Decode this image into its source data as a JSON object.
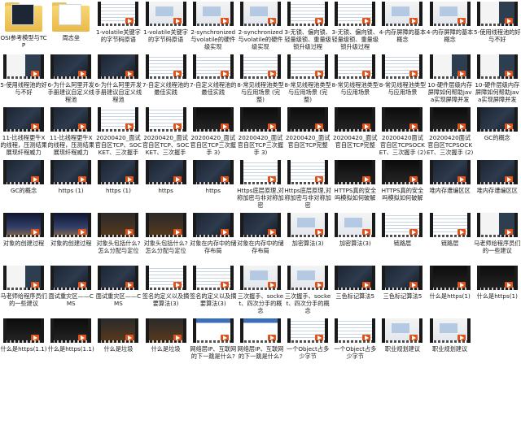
{
  "colors": {
    "film_border": "#1a1a1a",
    "play_badge": "#e0541b",
    "folder": "#eab94a",
    "label_text": "#1a1a1a"
  },
  "items": [
    {
      "type": "folder",
      "thumb": "dark",
      "label": "OSI参考模型与TCP"
    },
    {
      "type": "folder",
      "thumb": "light",
      "label": "周志垒"
    },
    {
      "type": "video",
      "thumb": "doc",
      "label": "1-volatile关键字的字节码原语"
    },
    {
      "type": "video",
      "thumb": "slide",
      "label": "1-volatile关键字的字节码原语"
    },
    {
      "type": "video",
      "thumb": "slide",
      "label": "2-synchronized与volatile的硬件级实现"
    },
    {
      "type": "video",
      "thumb": "slide",
      "label": "2-synchronized与volatile的硬件级实现"
    },
    {
      "type": "video",
      "thumb": "doc",
      "label": "3-无锁、偏向锁、轻量级锁、重量级锁升级过程"
    },
    {
      "type": "video",
      "thumb": "doc",
      "label": "3-无锁、偏向锁、轻量级锁、重量级锁升级过程"
    },
    {
      "type": "video",
      "thumb": "slide",
      "label": "4-内存屏障的基本概念"
    },
    {
      "type": "video",
      "thumb": "slide",
      "label": "4-内存屏障的基本概念"
    },
    {
      "type": "video",
      "thumb": "mixed",
      "label": "5-使用线程池的好与不好"
    },
    {
      "type": "video",
      "thumb": "mixed",
      "label": "5-使用线程池的好与不好"
    },
    {
      "type": "video",
      "thumb": "dark",
      "label": "6-为什么阿里开发手册建议自定义线程池"
    },
    {
      "type": "video",
      "thumb": "dark",
      "label": "6-为什么阿里开发手册建议自定义线程池"
    },
    {
      "type": "video",
      "thumb": "doc",
      "label": "7-自定义线程池的最佳实践"
    },
    {
      "type": "video",
      "thumb": "doc",
      "label": "7-自定义线程池的最佳实践"
    },
    {
      "type": "video",
      "thumb": "doc",
      "label": "8-常见线程池类型与应用场景 (完整)"
    },
    {
      "type": "video",
      "thumb": "doc",
      "label": "8-常见线程池类型与应用场景 (完整)"
    },
    {
      "type": "video",
      "thumb": "doc",
      "label": "8-常见线程池类型与应用场景"
    },
    {
      "type": "video",
      "thumb": "doc",
      "label": "8-常见线程池类型与应用场景"
    },
    {
      "type": "video",
      "thumb": "mixed",
      "label": "10-硬件层级内存屏障如何帮助java实现屏障并发"
    },
    {
      "type": "video",
      "thumb": "mixed",
      "label": "10-硬件层级内存屏障如何帮助java实现屏障并发"
    },
    {
      "type": "video",
      "thumb": "dark",
      "label": "11-比线程更牛X的线程，压测结果展现纤程威力"
    },
    {
      "type": "video",
      "thumb": "dark",
      "label": "11-比线程更牛X的线程，压测结果展现纤程威力"
    },
    {
      "type": "video",
      "thumb": "doc",
      "label": "20200420_面试官自区TCP、SOCKET、三次握手"
    },
    {
      "type": "video",
      "thumb": "doc",
      "label": "20200420_面试官自区TCP、SOCKET、三次握手"
    },
    {
      "type": "video",
      "thumb": "black",
      "label": "20200420_面试官自区TCP三次握手 3)"
    },
    {
      "type": "video",
      "thumb": "black",
      "label": "20200420_面试官自区TCP三次握手 3)"
    },
    {
      "type": "video",
      "thumb": "black",
      "label": "20200420_面试官自区TCP完整"
    },
    {
      "type": "video",
      "thumb": "black",
      "label": "20200420_面试官自区TCP完整"
    },
    {
      "type": "video",
      "thumb": "black",
      "label": "20200420面试官自区TCPSOCKET、三次握手 (2)"
    },
    {
      "type": "video",
      "thumb": "black",
      "label": "20200420面试官自区TCPSOCKET、三次握手 (2)"
    },
    {
      "type": "video",
      "thumb": "dark",
      "label": "GC的概念"
    },
    {
      "type": "video",
      "thumb": "dark",
      "label": "GC的概念"
    },
    {
      "type": "video",
      "thumb": "dark",
      "label": "https (1)"
    },
    {
      "type": "video",
      "thumb": "dark",
      "label": "https (1)"
    },
    {
      "type": "video",
      "thumb": "dark",
      "label": "https"
    },
    {
      "type": "video",
      "thumb": "dark",
      "label": "https"
    },
    {
      "type": "video",
      "thumb": "doc",
      "label": "Https底层原理,对称加密与非对称加密"
    },
    {
      "type": "video",
      "thumb": "doc",
      "label": "Https底层原理,对称加密与非对称加密"
    },
    {
      "type": "video",
      "thumb": "black",
      "label": "HTTPS真的安全吗模拟如何破解"
    },
    {
      "type": "video",
      "thumb": "black",
      "label": "HTTPS真的安全吗模拟如何破解"
    },
    {
      "type": "video",
      "thumb": "dark",
      "label": "堆内存遭编区区"
    },
    {
      "type": "video",
      "thumb": "dark",
      "label": "堆内存遭编区区"
    },
    {
      "type": "video",
      "thumb": "night",
      "label": "对象的创建过程"
    },
    {
      "type": "video",
      "thumb": "night",
      "label": "对象的创建过程"
    },
    {
      "type": "video",
      "thumb": "orange",
      "label": "对象头包括什么? 怎么分配与定位"
    },
    {
      "type": "video",
      "thumb": "orange",
      "label": "对象头包括什么? 怎么分配与定位"
    },
    {
      "type": "video",
      "thumb": "dark",
      "label": "对象在内存中的储存布局"
    },
    {
      "type": "video",
      "thumb": "dark",
      "label": "对象在内存中的储存布局"
    },
    {
      "type": "video",
      "thumb": "slide",
      "label": "加密算法(3)"
    },
    {
      "type": "video",
      "thumb": "slide",
      "label": "加密算法(3)"
    },
    {
      "type": "video",
      "thumb": "doc",
      "label": "链路层"
    },
    {
      "type": "video",
      "thumb": "doc",
      "label": "链路层"
    },
    {
      "type": "video",
      "thumb": "mixed",
      "label": "马老师给程序员们的一些建议"
    },
    {
      "type": "video",
      "thumb": "mixed",
      "label": "马老师给程序员们的一些建议"
    },
    {
      "type": "video",
      "thumb": "dark",
      "label": "面试重灾区——CMS"
    },
    {
      "type": "video",
      "thumb": "dark",
      "label": "面试重灾区——CMS"
    },
    {
      "type": "video",
      "thumb": "doc",
      "label": "签名的定义以及摘要算法(3)"
    },
    {
      "type": "video",
      "thumb": "doc",
      "label": "签名的定义以及摘要算法(3)"
    },
    {
      "type": "video",
      "thumb": "slide",
      "label": "三次握手、socket、四次分手的概念"
    },
    {
      "type": "video",
      "thumb": "slide",
      "label": "三次握手、socket、四次分手的概念"
    },
    {
      "type": "video",
      "thumb": "dark",
      "label": "三色标记算法5"
    },
    {
      "type": "video",
      "thumb": "dark",
      "label": "三色标记算法5"
    },
    {
      "type": "video",
      "thumb": "black",
      "label": "什么是https(1)"
    },
    {
      "type": "video",
      "thumb": "black",
      "label": "什么是https(1)"
    },
    {
      "type": "video",
      "thumb": "black",
      "label": "什么是https(1.1)"
    },
    {
      "type": "video",
      "thumb": "black",
      "label": "什么是https(1.1)"
    },
    {
      "type": "video",
      "thumb": "orange",
      "label": "什么是垃圾"
    },
    {
      "type": "video",
      "thumb": "orange",
      "label": "什么是垃圾"
    },
    {
      "type": "video",
      "thumb": "web",
      "label": "网络层IP、互联网的下一跳是什么?"
    },
    {
      "type": "video",
      "thumb": "web",
      "label": "网络层IP、互联网的下一跳是什么?"
    },
    {
      "type": "video",
      "thumb": "doc",
      "label": "一个Object占多少字节"
    },
    {
      "type": "video",
      "thumb": "doc",
      "label": "一个Object占多少字节"
    },
    {
      "type": "video",
      "thumb": "slide",
      "label": "职业规划建议"
    },
    {
      "type": "video",
      "thumb": "slide",
      "label": "职业规划建议"
    }
  ]
}
